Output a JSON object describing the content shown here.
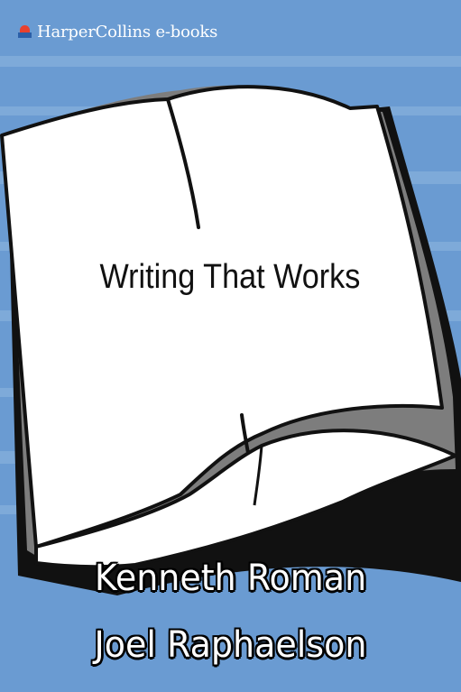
{
  "publisher": {
    "name": "HarperCollins e-books",
    "logo_icon": "fire-and-water-logo",
    "logo_colors": [
      "#e8412f",
      "#2b5fa8"
    ]
  },
  "book": {
    "title": "Writing That Works",
    "authors": [
      "Kenneth Roman",
      "Joel Raphaelson"
    ]
  },
  "colors": {
    "background": "#6a9bd2",
    "stripe": "#8fb7e0",
    "page": "#ffffff",
    "shadow": "#111111",
    "page_edge": "#7d7d7d"
  }
}
